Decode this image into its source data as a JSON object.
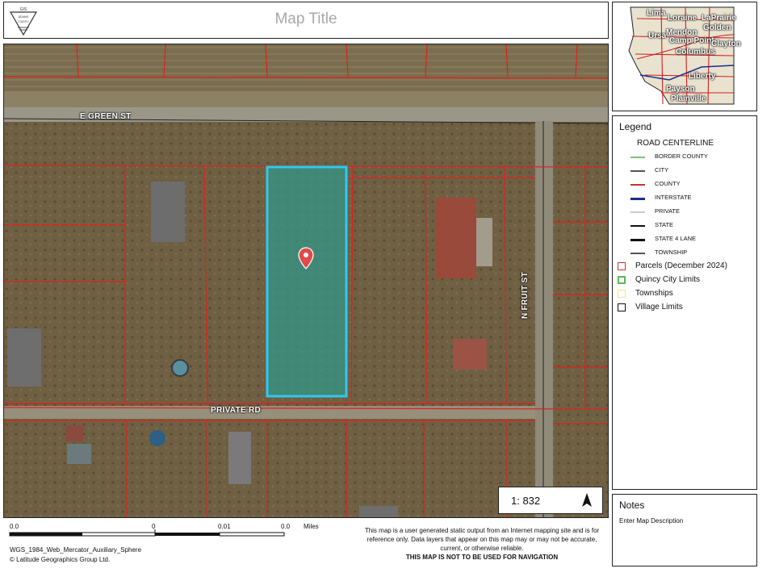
{
  "header": {
    "logo_lines": [
      "GIS",
      "ADAMS",
      "COUNTY"
    ],
    "title": "Map Title"
  },
  "map": {
    "street_labels": [
      "E GREEN ST",
      "PRIVATE RD",
      "N FRUIT ST"
    ],
    "scale_ratio": "1: 832",
    "north_arrow_icon": "north-arrow-icon",
    "marker_icon": "location-pin-icon",
    "colors": {
      "parcel_line": "#e0201c",
      "selected_parcel_stroke": "#2fc8f0",
      "selected_parcel_fill": "#2f9a8a"
    }
  },
  "scalebar": {
    "ticks": [
      "0.0",
      "0",
      "0.01",
      "0.0"
    ],
    "unit": "Miles"
  },
  "footer": {
    "projection": "WGS_1984_Web_Mercator_Auxiliary_Sphere",
    "copyright": "© Latitude Geographics Group Ltd.",
    "disclaimer": "This map is a user generated static output from an Internet mapping site and is for reference only. Data layers that appear on this map may or may not be accurate, current, or otherwise reliable.",
    "nav_warning": "THIS MAP IS NOT TO BE USED FOR NAVIGATION"
  },
  "overview": {
    "places": [
      "Lima",
      "Loraine",
      "LaPrairie",
      "Ursa",
      "Golden",
      "Mendon",
      "Camp Point",
      "Clayton",
      "Columbus",
      "Liberty",
      "Payson",
      "Plainville"
    ]
  },
  "legend": {
    "title": "Legend",
    "road_heading": "ROAD CENTERLINE",
    "road_items": [
      {
        "label": "BORDER COUNTY",
        "color": "#7fbf7f"
      },
      {
        "label": "CITY",
        "color": "#555555"
      },
      {
        "label": "COUNTY",
        "color": "#c0392b"
      },
      {
        "label": "INTERSTATE",
        "color": "#1f2d8c"
      },
      {
        "label": "PRIVATE",
        "color": "#cccccc"
      },
      {
        "label": "STATE",
        "color": "#111111"
      },
      {
        "label": "STATE 4 LANE",
        "color": "#111111"
      },
      {
        "label": "TOWNSHIP",
        "color": "#555555"
      }
    ],
    "layer_items": [
      {
        "label": "Parcels (December 2024)",
        "color": "#c0392b",
        "style": "solid-box"
      },
      {
        "label": "Quincy City Limits",
        "color": "#5cb85c",
        "style": "dashed-box"
      },
      {
        "label": "Townships",
        "color": "#f0e68c",
        "style": "solid-box"
      },
      {
        "label": "Village Limits",
        "color": "#111111",
        "style": "solid-box"
      }
    ]
  },
  "notes": {
    "title": "Notes",
    "text": "Enter Map Description"
  }
}
